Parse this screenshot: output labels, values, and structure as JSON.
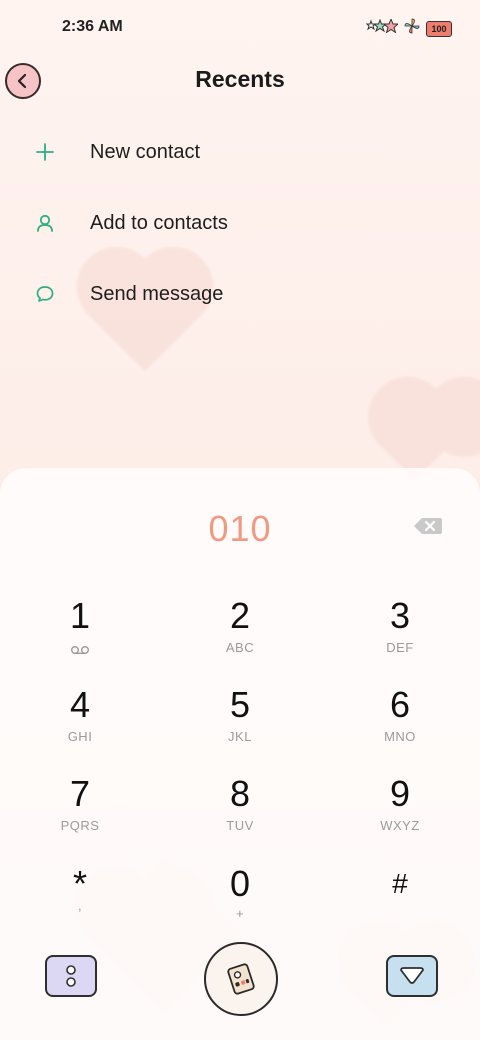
{
  "status_bar": {
    "time": "2:36 AM",
    "battery": "100"
  },
  "header": {
    "title": "Recents"
  },
  "actions": [
    {
      "label": "New contact",
      "icon": "plus-icon"
    },
    {
      "label": "Add to contacts",
      "icon": "person-icon"
    },
    {
      "label": "Send message",
      "icon": "chat-bubble-icon"
    }
  ],
  "dialer": {
    "number": "010",
    "keys": [
      {
        "digit": "1",
        "letters": ""
      },
      {
        "digit": "2",
        "letters": "ABC"
      },
      {
        "digit": "3",
        "letters": "DEF"
      },
      {
        "digit": "4",
        "letters": "GHI"
      },
      {
        "digit": "5",
        "letters": "JKL"
      },
      {
        "digit": "6",
        "letters": "MNO"
      },
      {
        "digit": "7",
        "letters": "PQRS"
      },
      {
        "digit": "8",
        "letters": "TUV"
      },
      {
        "digit": "9",
        "letters": "WXYZ"
      },
      {
        "digit": "*",
        "letters": ","
      },
      {
        "digit": "0",
        "letters": "+"
      },
      {
        "digit": "#",
        "letters": ""
      }
    ]
  },
  "colors": {
    "accent_green": "#2fae83",
    "number_color": "#f19a82"
  }
}
